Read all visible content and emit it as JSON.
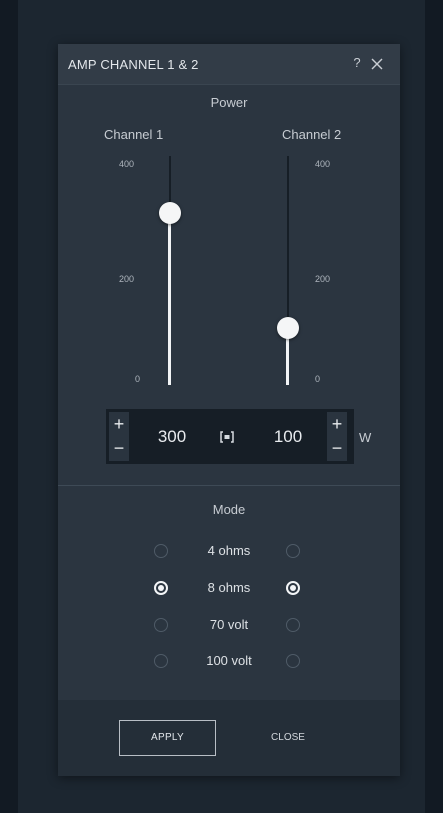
{
  "dialog": {
    "title": "AMP CHANNEL 1 & 2",
    "help_label": "?"
  },
  "power": {
    "heading": "Power",
    "unit": "W",
    "scale_ticks": [
      "400",
      "200",
      "0"
    ],
    "max": 400,
    "channel1": {
      "label": "Channel 1",
      "value": "300",
      "fraction": 0.75
    },
    "channel2": {
      "label": "Channel 2",
      "value": "100",
      "fraction": 0.25
    },
    "plus_label": "+",
    "minus_label": "−"
  },
  "mode": {
    "heading": "Mode",
    "options": [
      {
        "label": "4 ohms",
        "ch1_selected": false,
        "ch2_selected": false
      },
      {
        "label": "8 ohms",
        "ch1_selected": true,
        "ch2_selected": true
      },
      {
        "label": "70 volt",
        "ch1_selected": false,
        "ch2_selected": false
      },
      {
        "label": "100 volt",
        "ch1_selected": false,
        "ch2_selected": false
      }
    ]
  },
  "footer": {
    "apply_label": "APPLY",
    "close_label": "CLOSE"
  },
  "colors": {
    "panel": "#2b3540",
    "accent": "#f3f5f7",
    "track": "#161e26"
  }
}
